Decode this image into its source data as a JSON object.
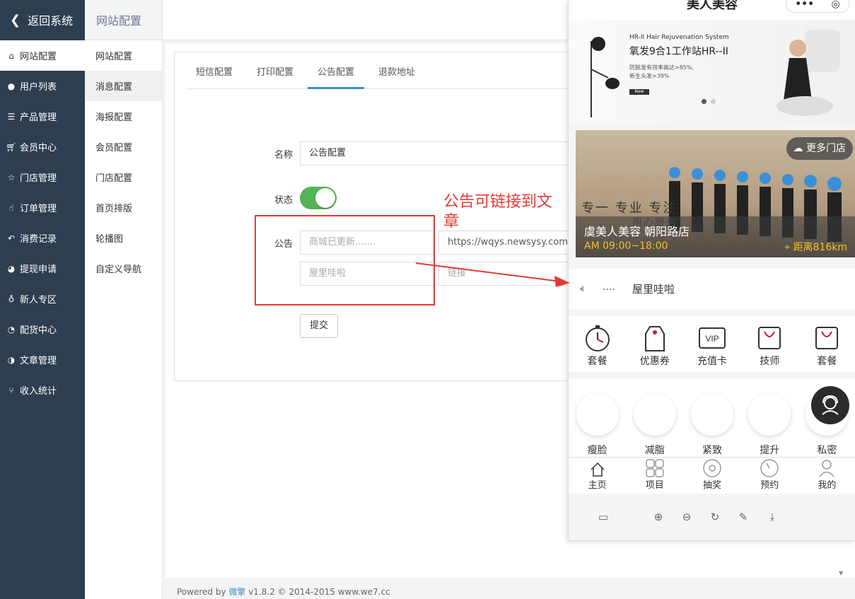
{
  "sidebar": {
    "back_label": "返回系统",
    "items": [
      {
        "label": "网站配置",
        "icon": "home-icon"
      },
      {
        "label": "用户列表",
        "icon": "user-icon"
      },
      {
        "label": "产品管理",
        "icon": "server-icon"
      },
      {
        "label": "会员中心",
        "icon": "cart-icon"
      },
      {
        "label": "门店管理",
        "icon": "star-icon"
      },
      {
        "label": "订单管理",
        "icon": "thumbs-up-icon"
      },
      {
        "label": "消费记录",
        "icon": "reply-icon"
      },
      {
        "label": "提现申请",
        "icon": "wechat-icon"
      },
      {
        "label": "新人专区",
        "icon": "pin-icon"
      },
      {
        "label": "配货中心",
        "icon": "pie-chart-icon"
      },
      {
        "label": "文章管理",
        "icon": "contrast-icon"
      },
      {
        "label": "收入统计",
        "icon": "fork-icon"
      }
    ]
  },
  "subnav": {
    "title": "网站配置",
    "items": [
      "网站配置",
      "消息配置",
      "海报配置",
      "会员配置",
      "门店配置",
      "首页排版",
      "轮播图",
      "自定义导航"
    ]
  },
  "tabs": [
    "短信配置",
    "打印配置",
    "公告配置",
    "退款地址"
  ],
  "form": {
    "name_label": "名称",
    "name_value": "公告配置",
    "status_label": "状态",
    "status_on": true,
    "notice_label": "公告",
    "notice_rows": [
      {
        "title": "商城已更新.......",
        "link": "https://wqys.newsysy.com/a"
      },
      {
        "title": "屋里哇啦",
        "link": "链接"
      }
    ],
    "submit_label": "提交"
  },
  "annotation": {
    "text": "公告可链接到文章",
    "color": "#e53935"
  },
  "footer": {
    "prefix": "Powered by ",
    "brand": "微擎",
    "suffix": " v1.8.2 © 2014-2015 www.we7.cc"
  },
  "phone": {
    "title": "美人美容",
    "capsule": "•••  ◎",
    "banner": {
      "line1": "HR-II Hair Rejuvenation System",
      "line2": "氧发9合1工作站HR--II",
      "line3a": "防脱发有效率高达>85%,",
      "line3b": "新生头发>39%",
      "badge": "New"
    },
    "store": {
      "more_label": "更多门店",
      "slogan": "专一 专业 专注",
      "slogan2": "用心服务",
      "name": "虞美人美容 朝阳路店",
      "hours": "AM 09:00~18:00",
      "distance": "距离816km"
    },
    "notice": {
      "dots": "....",
      "text": "屋里哇啦"
    },
    "grid1": [
      "套餐",
      "优惠券",
      "充值卡",
      "技师",
      "套餐"
    ],
    "grid2": [
      "瘦脸",
      "减脂",
      "紧致",
      "提升",
      "私密"
    ],
    "tabbar": [
      "主页",
      "项目",
      "抽奖",
      "预约",
      "我的"
    ]
  }
}
